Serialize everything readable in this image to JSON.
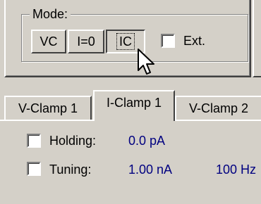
{
  "mode_group": {
    "label": "Mode:",
    "buttons": [
      {
        "label": "VC",
        "pressed": false
      },
      {
        "label": "I=0",
        "pressed": false
      },
      {
        "label": "IC",
        "pressed": true
      }
    ],
    "ext_checkbox": {
      "label": "Ext.",
      "checked": false
    }
  },
  "tabs": [
    {
      "label": "V-Clamp 1",
      "active": false
    },
    {
      "label": "I-Clamp 1",
      "active": true
    },
    {
      "label": "V-Clamp 2",
      "active": false
    }
  ],
  "rows": {
    "holding": {
      "label": "Holding:",
      "value": "0.0 pA",
      "checked": false
    },
    "tuning": {
      "label": "Tuning:",
      "value": "1.00 nA",
      "extra": "100 Hz",
      "checked": false
    }
  },
  "colors": {
    "value_text": "#000080",
    "face": "#d4d0c8"
  },
  "icons": {
    "cursor": "arrow-cursor-icon"
  }
}
